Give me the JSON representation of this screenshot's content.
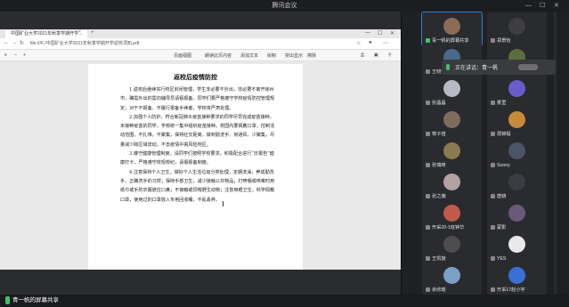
{
  "window": {
    "title": "腾讯会议"
  },
  "browser": {
    "tab_title": "中国矿业大学2021年秋季学期开学...",
    "url": "file:///F:/中国矿业大学2021年秋季学期开学返校须知.pdf",
    "toolbar": [
      "页面视图",
      "朗读此页内容",
      "添加文本",
      "绘制",
      "突出显示",
      "擦除"
    ]
  },
  "document": {
    "title": "返校后疫情防控",
    "paragraphs": [
      "1.返校后继续实行校区封闭管理，学生非必要不外出，非必要不离开徐州市，确需外出的需向辅导员请假报备。同学们要严格遵守学校疫情防控管理规定，对于不报备、不履行报备手续者，学校将严肃处理。",
      "2.加强个人防护，符合新冠肺炎疫苗接种要求的同学尽早完成疫苗接种，未接种疫苗的同学，学校统一集中组织疫苗接种。校园内要佩戴口罩，控制活动范围，不扎堆，不聚集，保持社交距离，做到勤洗手、常通风、少聚集，尽量减少跨区域流动，不去疫情中高风险地区。",
      "3.遵守健康管理制度，请同学们按照学校要求，积极配合进行“日报告”健康打卡，严格遵守校规校纪，请假报备制度。",
      "4.注意保持个人卫生，做好个人生活垃圾分类处理，定期洗澡，养成勤洗手、正确洗手的习惯；保持手部卫生，减少接触公共物品；打喷嚏或咳嗽时用纸巾或手肘衣服遮住口鼻；不接触或饲喂野生动物；注意用眼卫生，科学佩戴口罩，使用过的口罩放入专用回收桶，不乱丢弃。"
    ]
  },
  "screen_share": {
    "sharer_label": "青一帆的屏幕共享"
  },
  "speaking": {
    "label": "正在讲话：青一帆"
  },
  "participants": [
    {
      "name": "青一帆的屏幕共享",
      "avatar_color": "#8c6b58",
      "mic": "on",
      "active": true
    },
    {
      "name": "郑景怡",
      "avatar_color": "#3d3d42",
      "mic": "muted",
      "active": false
    },
    {
      "name": "王晓宇",
      "avatar_color": "#4a6a8a",
      "mic": "muted",
      "active": false
    },
    {
      "name": "李泽峰",
      "avatar_color": "#5d6e3e",
      "mic": "muted",
      "active": false
    },
    {
      "name": "张晶晶",
      "avatar_color": "#b9b9c4",
      "mic": "muted",
      "active": false
    },
    {
      "name": "雾里",
      "avatar_color": "#6a5cc9",
      "mic": "muted",
      "active": false
    },
    {
      "name": "寒子煊",
      "avatar_color": "#7c6d5f",
      "mic": "muted",
      "active": false
    },
    {
      "name": "周锦程",
      "avatar_color": "#c78a3a",
      "mic": "muted",
      "active": false
    },
    {
      "name": "张瑞琦",
      "avatar_color": "#8a7a52",
      "mic": "muted",
      "active": false
    },
    {
      "name": "Sunny",
      "avatar_color": "#4b5563",
      "mic": "muted",
      "active": false
    },
    {
      "name": "张之瀚",
      "avatar_color": "#b3a2a2",
      "mic": "muted",
      "active": false
    },
    {
      "name": "唐婧",
      "avatar_color": "#3c3d42",
      "mic": "muted",
      "active": false
    },
    {
      "name": "开采20-1班钟华",
      "avatar_color": "#c05a4a",
      "mic": "muted",
      "active": false
    },
    {
      "name": "蒙影",
      "avatar_color": "#6a5a7a",
      "mic": "muted",
      "active": false
    },
    {
      "name": "王凯旋",
      "avatar_color": "#4d4d4d",
      "mic": "muted",
      "active": false
    },
    {
      "name": "YES",
      "avatar_color": "#e9e9e9",
      "mic": "muted",
      "active": false
    },
    {
      "name": "余欣瑶",
      "avatar_color": "#7aa0c8",
      "mic": "muted",
      "active": false
    },
    {
      "name": "开采17赵小宇",
      "avatar_color": "#3a6fd8",
      "mic": "muted",
      "active": false
    }
  ]
}
